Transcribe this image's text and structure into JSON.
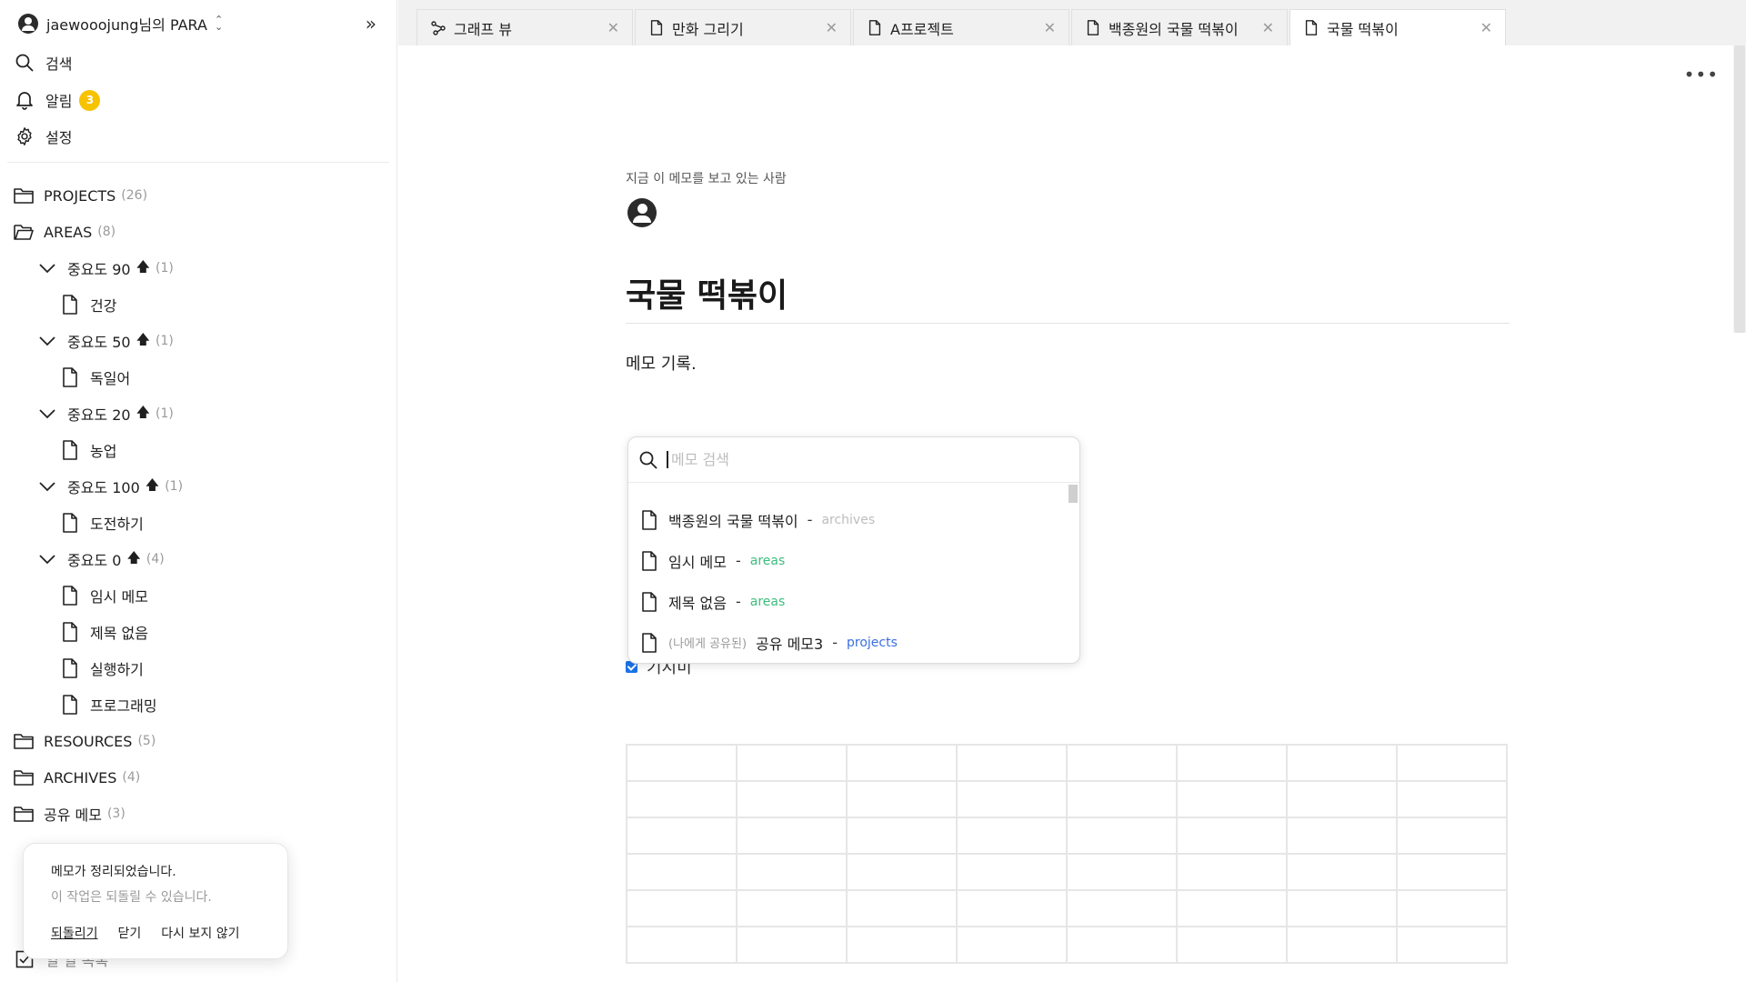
{
  "workspace": {
    "name": "jaewooojung님의 PARA"
  },
  "quick": {
    "search": "검색",
    "alerts": "알림",
    "alerts_count": "3",
    "settings": "설정"
  },
  "tree": {
    "projects": {
      "label": "PROJECTS",
      "count": "(26)"
    },
    "areas": {
      "label": "AREAS",
      "count": "(8)"
    },
    "groups": [
      {
        "label": "중요도 90",
        "count": "(1)",
        "items": [
          "건강"
        ]
      },
      {
        "label": "중요도 50",
        "count": "(1)",
        "items": [
          "독일어"
        ]
      },
      {
        "label": "중요도 20",
        "count": "(1)",
        "items": [
          "농업"
        ]
      },
      {
        "label": "중요도 100",
        "count": "(1)",
        "items": [
          "도전하기"
        ]
      },
      {
        "label": "중요도 0",
        "count": "(4)",
        "items": [
          "임시 메모",
          "제목 없음",
          "실행하기",
          "프로그래밍"
        ]
      }
    ],
    "resources": {
      "label": "RESOURCES",
      "count": "(5)"
    },
    "archives": {
      "label": "ARCHIVES",
      "count": "(4)"
    },
    "shared": {
      "label": "공유 메모",
      "count": "(3)"
    },
    "bottom_partial": "일 일 목록"
  },
  "toast": {
    "title": "메모가 정리되었습니다.",
    "subtitle": "이 작업은 되돌릴 수 있습니다.",
    "undo": "되돌리기",
    "close": "닫기",
    "never": "다시 보지 않기"
  },
  "tabs": [
    {
      "label": "그래프 뷰",
      "icon": "graph-icon"
    },
    {
      "label": "만화 그리기",
      "icon": "document-icon"
    },
    {
      "label": "A프로젝트",
      "icon": "document-icon"
    },
    {
      "label": "백종원의 국물 떡볶이",
      "icon": "document-icon"
    },
    {
      "label": "국물 떡볶이",
      "icon": "document-icon",
      "active": true
    }
  ],
  "doc": {
    "viewers_label": "지금 이 메모를 보고 있는 사람",
    "title": "국물 떡볶이",
    "body": "메모 기록.",
    "checkbox_label": "기지미"
  },
  "popup": {
    "placeholder": "메모 검색",
    "results": [
      {
        "title": "백종원의 국물 떡볶이",
        "tag": "archives",
        "tag_color": "#bdbdbd"
      },
      {
        "title": "임시 메모",
        "tag": "areas",
        "tag_color": "#3dbd7d"
      },
      {
        "title": "제목 없음",
        "tag": "areas",
        "tag_color": "#3dbd7d"
      },
      {
        "shared_prefix": "(나에게 공유된)",
        "title": "공유 메모3",
        "tag": "projects",
        "tag_color": "#3b6fe0"
      }
    ]
  },
  "colors": {
    "badge": "#f7c200",
    "accent": "#1a73e8"
  }
}
